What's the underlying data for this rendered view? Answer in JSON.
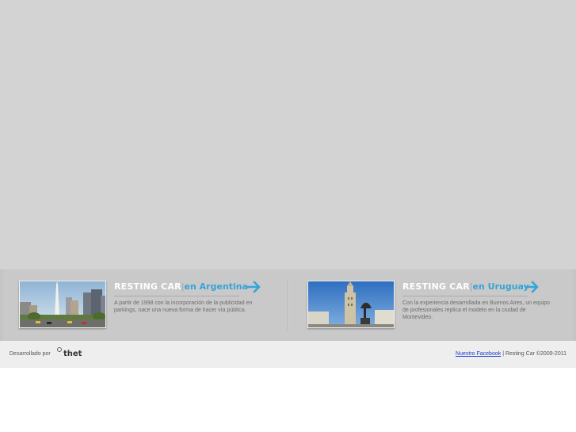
{
  "cards": [
    {
      "brand": "RESTING CAR",
      "sep": "|",
      "location": "en Argentina",
      "description": "A partir de 1998 con la incorporación de la publicidad en parkings, nace una nueva forma de hacer vía pública.",
      "image": "buenos-aires-obelisk-photo"
    },
    {
      "brand": "RESTING CAR",
      "sep": "|",
      "location": "en Uruguay",
      "description": "Con la experiencia desarrollada en Buenos Aires, un equipo de profesionales replica el modelo en la ciudad de Montevideo.",
      "image": "montevideo-plaza-photo"
    }
  ],
  "footer": {
    "developed_by": "Desarrollado por",
    "dev_logo": "thet",
    "facebook_link": "Nuestro Facebook",
    "separator": "|",
    "copyright": "Resting Car ©2009-2011"
  },
  "colors": {
    "hero_bg": "#d2d3d2",
    "band_bg": "#c8c9c8",
    "accent": "#35a4d8",
    "footer_bg": "#eeeeee",
    "link": "#1a3ccc"
  },
  "icons": {
    "card_arrow": "arrow-right-icon"
  }
}
